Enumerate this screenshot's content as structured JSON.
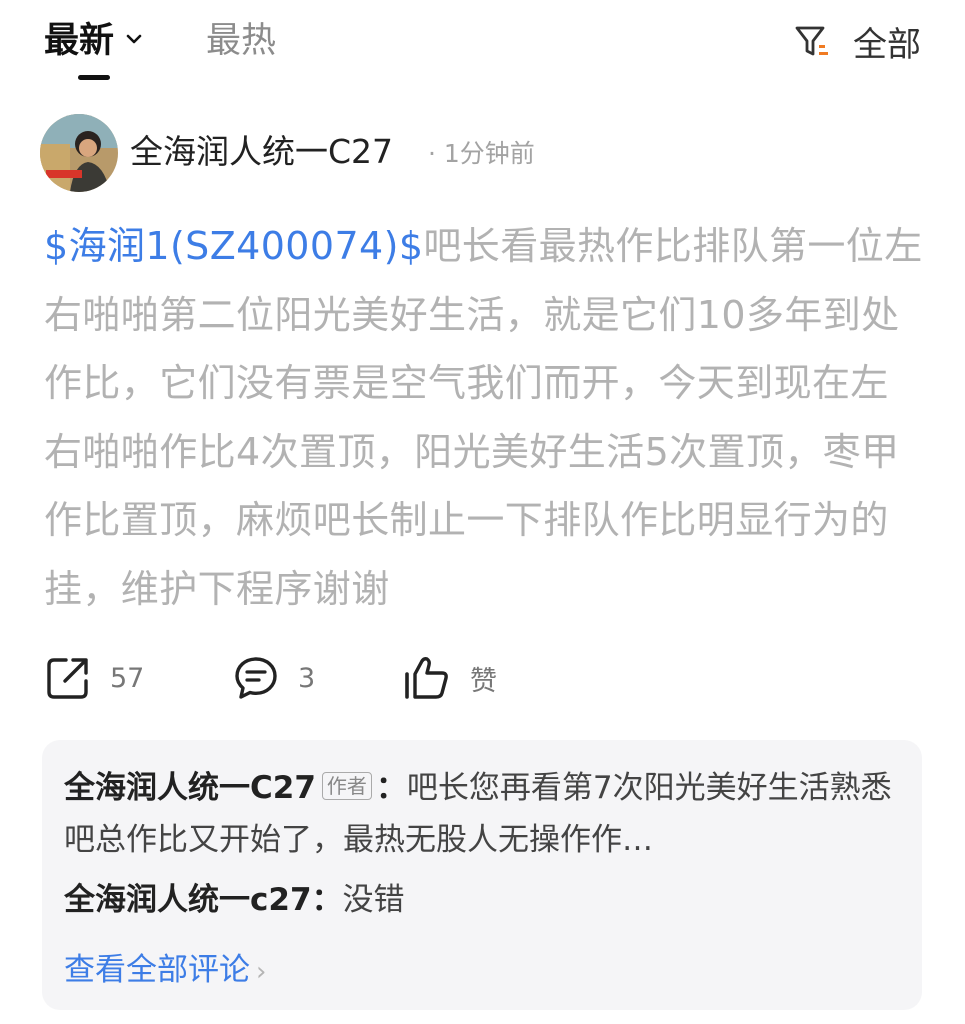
{
  "tabs": {
    "latest": "最新",
    "hot": "最热",
    "filter_label": "全部"
  },
  "post": {
    "author": "全海润人统一C27",
    "time": "· 1分钟前",
    "stock_tag": "$海润1(SZ400074)$",
    "text": "吧长看最热作比排队第一位左右啪啪第二位阳光美好生活，就是它们10多年到处作比，它们没有票是空气我们而开，今天到现在左右啪啪作比4次置顶，阳光美好生活5次置顶，枣甲作比置顶，麻烦吧长制止一下排队作比明显行为的挂，维护下程序谢谢"
  },
  "actions": {
    "share_count": "57",
    "comment_count": "3",
    "like_label": "赞"
  },
  "comments": {
    "c1_name": "全海润人统一C27",
    "c1_tag": "作者",
    "c1_colon": "：",
    "c1_text": "吧长您再看第7次阳光美好生活熟悉吧总作比又开始了，最热无股人无操作作…",
    "c2_name": "全海润人统一c27",
    "c2_colon": "：",
    "c2_text": "没错",
    "view_all": "查看全部评论"
  },
  "colors": {
    "link": "#3d7de6",
    "muted_text": "#b2b2b2",
    "comment_bg": "#f5f5f7"
  }
}
